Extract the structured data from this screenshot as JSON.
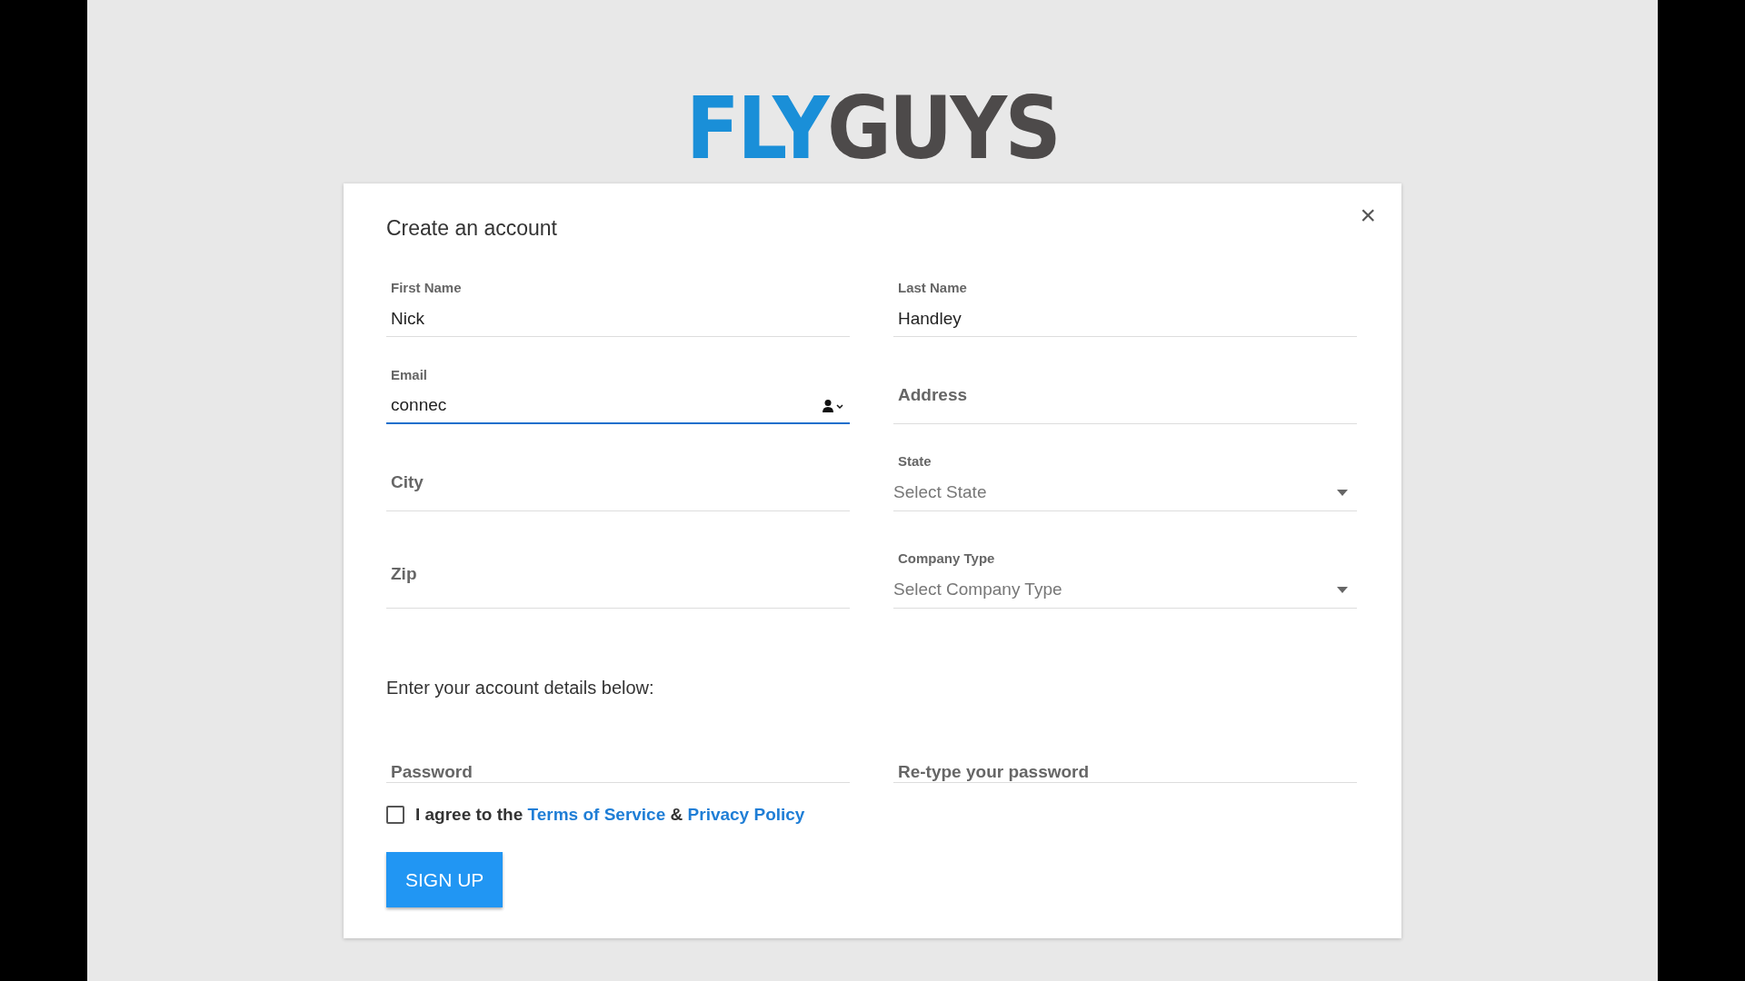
{
  "logo": {
    "first": "FLY",
    "second": "GUYS"
  },
  "dialog": {
    "title": "Create an account",
    "close": "×"
  },
  "fields": [
    {
      "kind": "text",
      "label": "First Name",
      "value": "Nick",
      "focused": false
    },
    {
      "kind": "text",
      "label": "Email",
      "value": "connec",
      "focused": true,
      "autofill_icon": true
    },
    {
      "kind": "empty",
      "placeholder": "City"
    },
    {
      "kind": "empty",
      "placeholder": "Zip"
    },
    {
      "kind": "text",
      "label": "Last Name",
      "value": "Handley",
      "focused": false
    },
    {
      "kind": "empty",
      "placeholder": "Address"
    },
    {
      "kind": "select",
      "label": "State",
      "placeholder": "Select State"
    },
    {
      "kind": "select",
      "label": "Company Type",
      "placeholder": "Select Company Type"
    }
  ],
  "account_heading": "Enter your account details below:",
  "password_fields": [
    {
      "placeholder": "Password"
    },
    {
      "placeholder": "Re-type your password"
    }
  ],
  "agree": {
    "checked": false,
    "parts": [
      {
        "kind": "text",
        "text": "I agree to the"
      },
      {
        "kind": "link",
        "text": "Terms of Service"
      },
      {
        "kind": "text",
        "text": "&"
      },
      {
        "kind": "link",
        "text": "Privacy Policy"
      }
    ]
  },
  "submit": "SIGN UP"
}
